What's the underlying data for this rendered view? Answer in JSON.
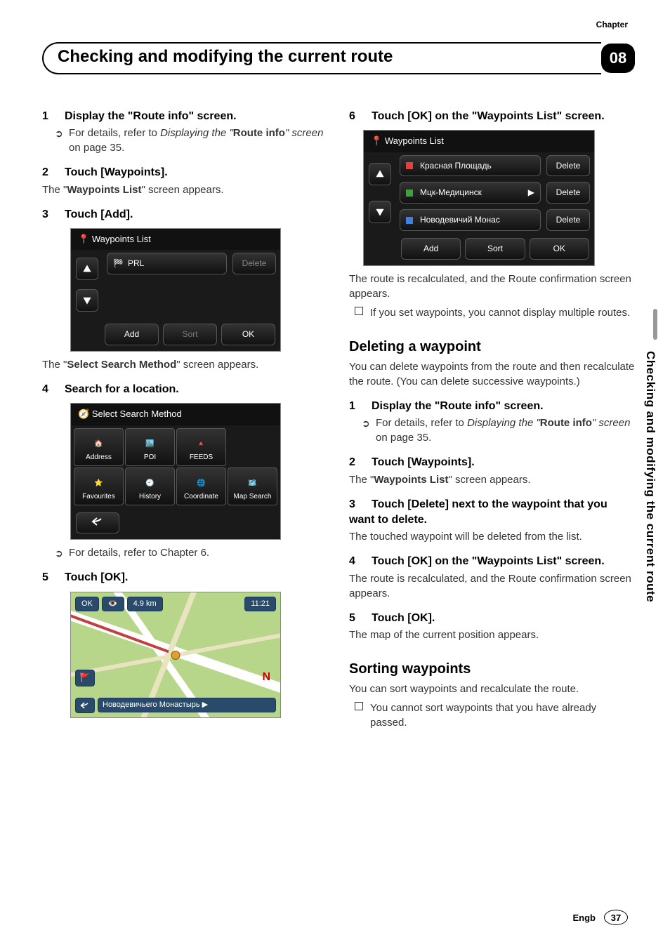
{
  "chapter_label": "Chapter",
  "chapter_number": "08",
  "page_title": "Checking and modifying the current route",
  "vertical_tab": "Checking and modifying the current route",
  "left": {
    "step1": {
      "num": "1",
      "head": "Display the \"Route info\" screen.",
      "bullet_pre": "For details, refer to ",
      "bullet_italic1": "Displaying the \"",
      "bullet_bold": "Route info",
      "bullet_italic2": "\" screen",
      "bullet_post": " on page 35."
    },
    "step2": {
      "num": "2",
      "head": "Touch [Waypoints].",
      "body_pre": "The \"",
      "body_bold": "Waypoints List",
      "body_post": "\" screen appears."
    },
    "step3": {
      "num": "3",
      "head": "Touch [Add]."
    },
    "ss1": {
      "title": "Waypoints List",
      "item1": "PRL",
      "delete": "Delete",
      "add": "Add",
      "sort": "Sort",
      "ok": "OK"
    },
    "after_ss1_pre": "The \"",
    "after_ss1_bold": "Select Search Method",
    "after_ss1_post": "\" screen appears.",
    "step4": {
      "num": "4",
      "head": "Search for a location."
    },
    "ss2": {
      "title": "Select Search Method",
      "cells": [
        "Address",
        "POI",
        "FEEDS",
        "",
        "Favourites",
        "History",
        "Coordinate",
        "Map Search"
      ]
    },
    "after_ss2": "For details, refer to Chapter 6.",
    "step5": {
      "num": "5",
      "head": "Touch [OK]."
    },
    "map": {
      "ok": "OK",
      "dist": "4.9 km",
      "time": "11:21",
      "n": "N",
      "dest": "Новодевичьего Монастырь"
    }
  },
  "right": {
    "step6": {
      "num": "6",
      "head": "Touch [OK] on the \"Waypoints List\" screen."
    },
    "ss3": {
      "title": "Waypoints List",
      "items": [
        "Красная Площадь",
        "Мцк-Медицинск",
        "Новодевичий Монас"
      ],
      "delete": "Delete",
      "add": "Add",
      "sort": "Sort",
      "ok": "OK"
    },
    "after_ss3": "The route is recalculated, and the Route confirmation screen appears.",
    "note1": "If you set waypoints, you cannot display multiple routes.",
    "delete_heading": "Deleting a waypoint",
    "delete_intro": "You can delete waypoints from the route and then recalculate the route. (You can delete successive waypoints.)",
    "dstep1": {
      "num": "1",
      "head": "Display the \"Route info\" screen.",
      "bullet_pre": "For details, refer to ",
      "bullet_italic1": "Displaying the \"",
      "bullet_bold": "Route info",
      "bullet_italic2": "\" screen",
      "bullet_post": " on page 35."
    },
    "dstep2": {
      "num": "2",
      "head": "Touch [Waypoints].",
      "body_pre": "The \"",
      "body_bold": "Waypoints List",
      "body_post": "\" screen appears."
    },
    "dstep3": {
      "num": "3",
      "head": "Touch [Delete] next to the waypoint that you want to delete.",
      "body": "The touched waypoint will be deleted from the list."
    },
    "dstep4": {
      "num": "4",
      "head": "Touch [OK] on the \"Waypoints List\" screen.",
      "body": "The route is recalculated, and the Route confirmation screen appears."
    },
    "dstep5": {
      "num": "5",
      "head": "Touch [OK].",
      "body": "The map of the current position appears."
    },
    "sort_heading": "Sorting waypoints",
    "sort_intro": "You can sort waypoints and recalculate the route.",
    "sort_note": "You cannot sort waypoints that you have already passed."
  },
  "footer": {
    "lang": "Engb",
    "page": "37"
  }
}
